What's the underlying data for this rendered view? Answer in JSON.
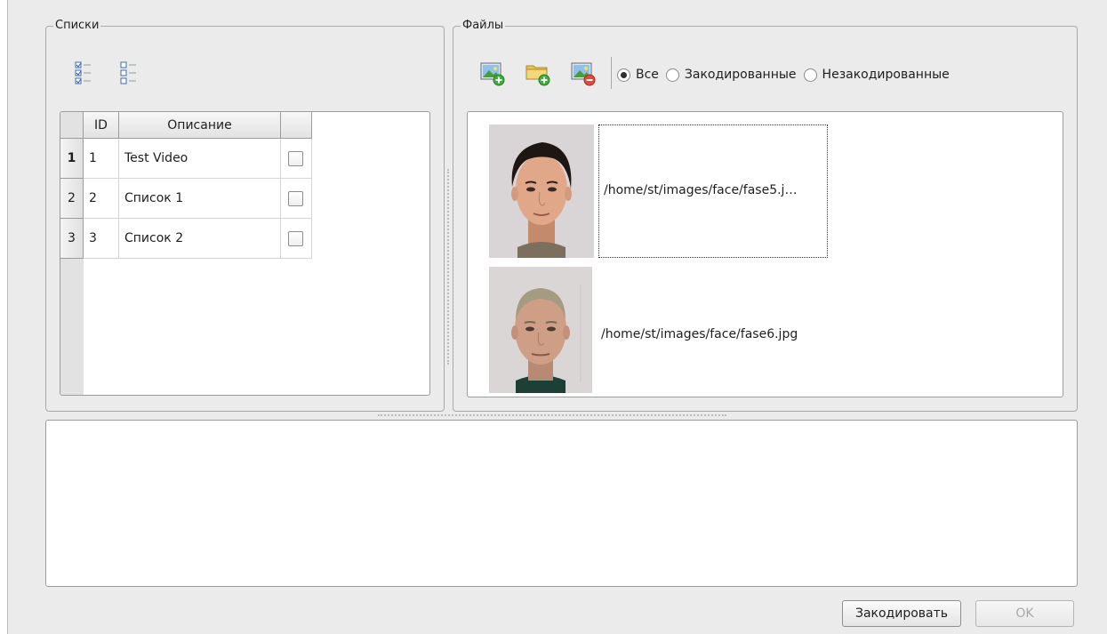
{
  "lists_group": {
    "title": "Списки",
    "toolbar": {
      "check_all_icon": "checklist-checked-icon",
      "uncheck_all_icon": "checklist-unchecked-icon"
    },
    "table": {
      "headers": [
        "ID",
        "Описание",
        ""
      ],
      "rows": [
        {
          "row_header": "1",
          "id": "1",
          "description": "Test Video",
          "checked": false
        },
        {
          "row_header": "2",
          "id": "2",
          "description": "Список 1",
          "checked": false
        },
        {
          "row_header": "3",
          "id": "3",
          "description": "Список 2",
          "checked": false
        }
      ],
      "current_row": 1
    }
  },
  "files_group": {
    "title": "Файлы",
    "toolbar": {
      "add_image_icon": "add-image-icon",
      "add_folder_icon": "add-folder-icon",
      "remove_image_icon": "remove-image-icon"
    },
    "filter": {
      "options": [
        "Все",
        "Закодированные",
        "Незакодированные"
      ],
      "selected": "Все"
    },
    "files": [
      {
        "path": "/home/st/images/face/fase5.j…",
        "thumbnail": "face-photo-young-man",
        "focused": true
      },
      {
        "path": "/home/st/images/face/fase6.jpg",
        "thumbnail": "face-photo-older-man",
        "focused": false
      }
    ]
  },
  "log": {
    "text": ""
  },
  "buttons": {
    "encode_label": "Закодировать",
    "ok_label": "OK",
    "ok_enabled": false
  }
}
